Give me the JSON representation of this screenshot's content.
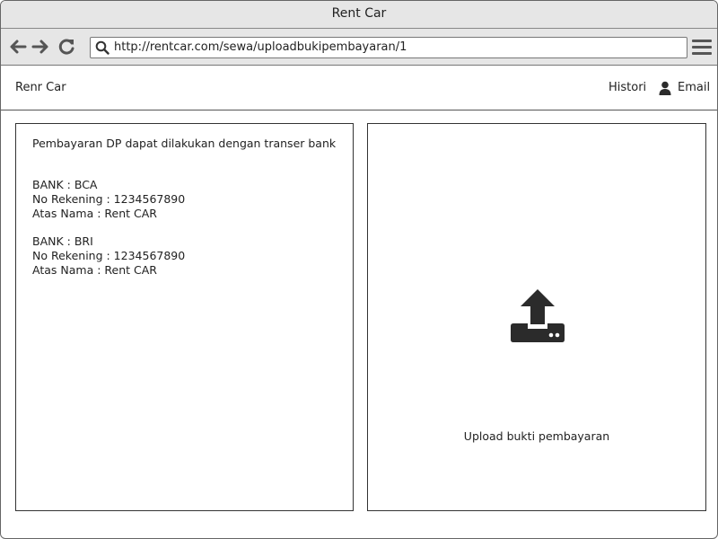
{
  "window": {
    "title": "Rent Car"
  },
  "browser": {
    "url": "http://rentcar.com/sewa/uploadbukipembayaran/1",
    "icons": [
      "back-arrow-icon",
      "forward-arrow-icon",
      "reload-icon",
      "search-icon",
      "hamburger-menu-icon"
    ]
  },
  "app": {
    "brand": "Renr Car",
    "nav": {
      "history": "Histori",
      "account": "Email"
    }
  },
  "payment_info": {
    "intro": "Pembayaran DP dapat dilakukan dengan transer bank",
    "banks": [
      {
        "bank": "BANK : BCA",
        "account": "No Rekening : 1234567890",
        "holder": "Atas Nama : Rent CAR"
      },
      {
        "bank": "BANK : BRI",
        "account": "No Rekening : 1234567890",
        "holder": "Atas Nama : Rent CAR"
      }
    ]
  },
  "upload": {
    "label": "Upload bukti pembayaran",
    "icon": "upload-icon"
  },
  "colors": {
    "chrome": "#e6e6e6",
    "border": "#333333",
    "icon": "#2b2b2b"
  }
}
